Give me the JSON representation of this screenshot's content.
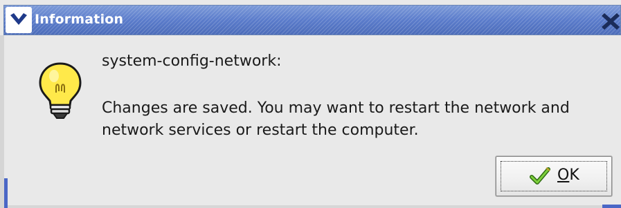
{
  "window": {
    "title": "Information",
    "menu_icon": "chevron-down-icon",
    "close_icon": "close-icon"
  },
  "message": {
    "icon": "lightbulb-icon",
    "primary": "system-config-network:",
    "secondary": "Changes are saved. You may want to restart the network and network services or restart the computer."
  },
  "actions": {
    "ok": {
      "icon": "checkmark-icon",
      "mnemonic": "O",
      "rest": "K"
    }
  },
  "colors": {
    "titlebar": "#5d7fc8",
    "dialog_bg": "#e9e9e9",
    "accent": "#4a67c6",
    "bulb_fill": "#ffe94a"
  }
}
